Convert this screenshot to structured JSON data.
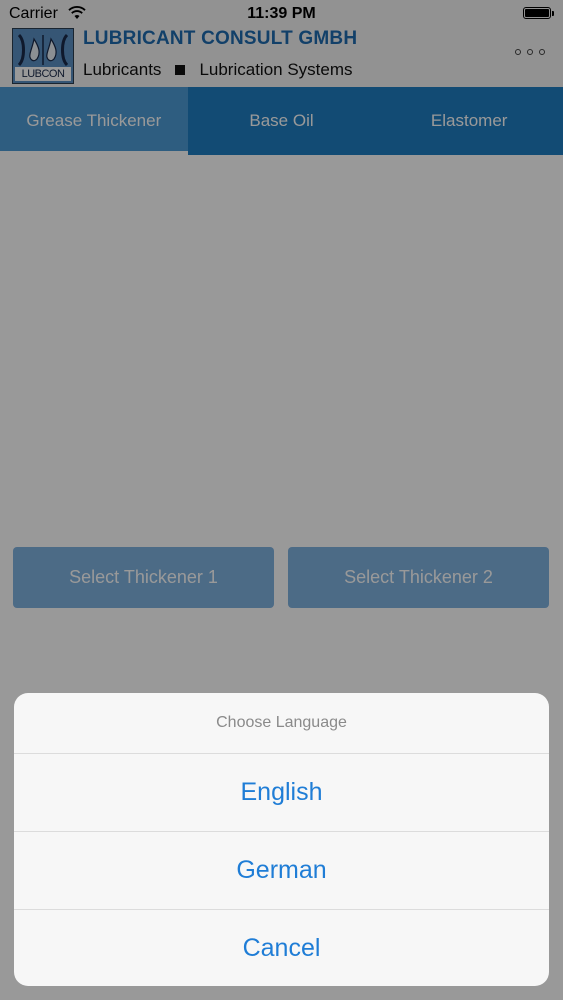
{
  "status": {
    "carrier": "Carrier",
    "time": "11:39 PM"
  },
  "header": {
    "logo_text": "LUBCON",
    "company_name": "LUBRICANT CONSULT GMBH",
    "tagline_left": "Lubricants",
    "tagline_right": "Lubrication Systems"
  },
  "tabs": [
    {
      "label": "Grease Thickener",
      "active": true
    },
    {
      "label": "Base Oil",
      "active": false
    },
    {
      "label": "Elastomer",
      "active": false
    }
  ],
  "main": {
    "select_1": "Select Thickener 1",
    "select_2": "Select Thickener 2"
  },
  "action_sheet": {
    "title": "Choose Language",
    "options": [
      "English",
      "German",
      "Cancel"
    ]
  },
  "colors": {
    "brand_blue": "#1f7dc1",
    "link_blue": "#1f7dd6",
    "company_blue": "#1f6bb0"
  }
}
